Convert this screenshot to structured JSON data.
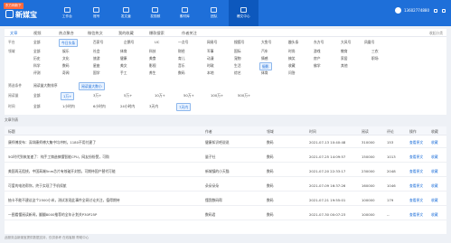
{
  "app": {
    "badge": "东方网新下",
    "name": "新媒宝"
  },
  "nav": [
    {
      "label": "工作台"
    },
    {
      "label": "账号"
    },
    {
      "label": "发文章"
    },
    {
      "label": "发视频"
    },
    {
      "label": "素材库"
    },
    {
      "label": "团队"
    },
    {
      "label": "爆文中心"
    }
  ],
  "user": {
    "phone": "13602774880"
  },
  "tabs": [
    "文章",
    "视频",
    "热点聚合",
    "微信热文",
    "我的收藏",
    "爆款搜索",
    "作者关注"
  ],
  "tabs_right_link": "收起分类",
  "platform": {
    "label": "平台",
    "options": [
      "全部",
      "今日头条",
      "百家号",
      "企鹅号",
      "UC",
      "一点号",
      "网易号",
      "搜狐号",
      "大鱼号",
      "趣头条",
      "东方号",
      "大风号",
      "凤凰号"
    ]
  },
  "category": {
    "label": "领域",
    "rows": [
      [
        "全部",
        "娱乐",
        "社会",
        "体育",
        "科技",
        "财经",
        "军事",
        "国际",
        "汽车",
        "时尚",
        "游戏",
        "教育",
        "三农"
      ],
      [
        "历史",
        "文化",
        "旅游",
        "健康",
        "美食",
        "育儿",
        "动漫",
        "宠物",
        "情感",
        "搞笑",
        "房产",
        "家居",
        "职场"
      ],
      [
        "科学",
        "数码",
        "星座",
        "美文",
        "影视",
        "音乐",
        "时政",
        "生活",
        "摄影",
        "收藏",
        "佛学",
        "其他"
      ],
      [
        "评测",
        "奇闻",
        "国学",
        "手工",
        "养生",
        "数码",
        "本地",
        "综艺",
        "体育",
        "问答"
      ]
    ]
  },
  "filter": {
    "label": "筛选条件",
    "sort_options": [
      "阅读量大数排序",
      "阅读量大数小"
    ],
    "range_label": "阅读量",
    "ranges": [
      "全部",
      "1万+",
      "3万+",
      "5万+",
      "10万+",
      "50万+",
      "100万+",
      "500万+"
    ],
    "time_label": "时间",
    "times": [
      "全部",
      "1小时内",
      "6小时内",
      "24小时内",
      "3天内",
      "7天内"
    ]
  },
  "list": {
    "header": "文章列表"
  },
  "table": {
    "columns": [
      "标题",
      "作者",
      "领域",
      "时间",
      "阅读",
      "评论",
      "操作",
      "收藏"
    ],
    "rows": [
      {
        "title": "康师傅发布：深圳康师傅大集中均冲刺，1180不用付建了",
        "author": "健康知识吧说说",
        "field": "数码",
        "time": "2021-07-13 10:40:48",
        "reads": "310000",
        "comments": "153",
        "op": "查看原文",
        "fav": "收藏"
      },
      {
        "title": "5G时代到来加速了：纯手工铸造搞懂智能CPU，网友纷纷赞，可购",
        "author": "量子社",
        "field": "数码",
        "time": "2021-07-25 14:09:57",
        "reads": "150000",
        "comments": "1013",
        "op": "查看原文",
        "fav": "收藏"
      },
      {
        "title": "美国再无阻挠，中国高端5nm芯片有效破开封锁，可期待国产替代可能",
        "author": "新城镇的小天猫",
        "field": "数码",
        "time": "2021-07-20 22:33:17",
        "reads": "230000",
        "comments": "2048",
        "op": "查看原文",
        "fav": "收藏"
      },
      {
        "title": "可爱的电池帮你，终于实现了手机续航",
        "author": "朵朵朵朵",
        "field": "数码",
        "time": "2021-07-09 16:37:26",
        "reads": "160000",
        "comments": "1046",
        "op": "查看原文",
        "fav": "收藏"
      },
      {
        "title": "抽卡不能不建议这个2500小米，测试发现此事件全网讨论关注，值得期待",
        "author": "懂我数码帮",
        "field": "数码",
        "time": "2021-07-21 19:55:01",
        "reads": "100000",
        "comments": "179",
        "op": "查看原文",
        "fav": "收藏"
      },
      {
        "title": "一图看懂阅读新闻，翻翻8000推荐的全年计划关P30P25P",
        "author": "数码君",
        "field": "数码",
        "time": "2021-07-30 00:07:23",
        "reads": "100000",
        "comments": "--",
        "op": "查看原文",
        "fav": "收藏"
      },
      {
        "title": "",
        "author": "",
        "field": "",
        "time": "",
        "reads": "",
        "comments": "",
        "op": "",
        "fav": ""
      }
    ]
  },
  "footer": {
    "text": "此服务由新媒宝提供数据支持，仅供参考  在线客服 帮助中心"
  }
}
